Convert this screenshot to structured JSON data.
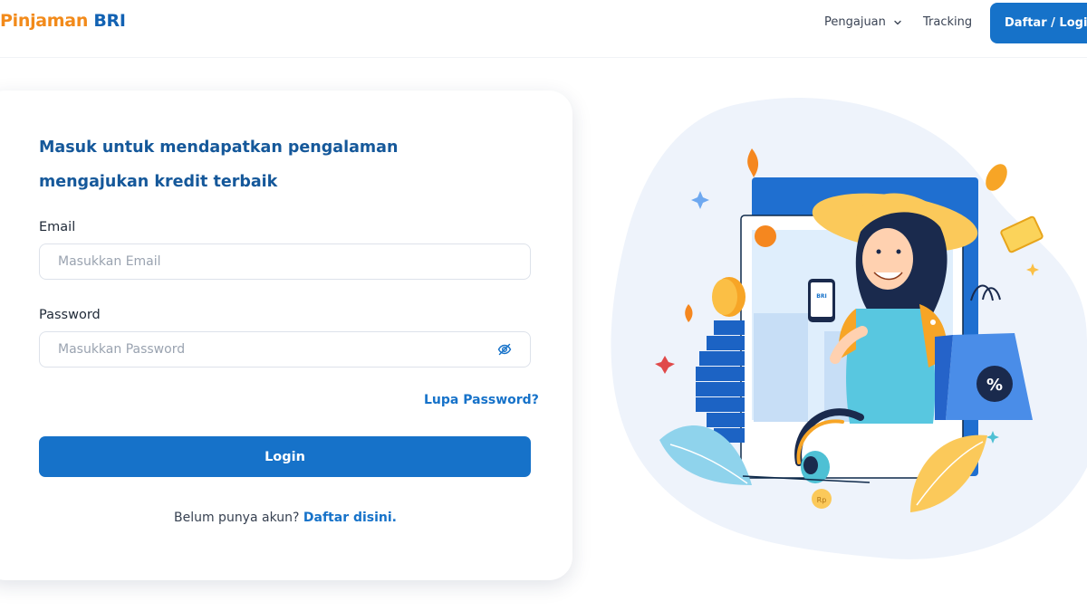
{
  "header": {
    "logo_part1": "Pinjaman",
    "logo_part2": "BRI",
    "nav": {
      "pengajuan": "Pengajuan",
      "tracking": "Tracking"
    },
    "auth_button": "Daftar / Login"
  },
  "form": {
    "heading": "Masuk untuk mendapatkan pengalaman mengajukan kredit terbaik",
    "email_label": "Email",
    "email_placeholder": "Masukkan Email",
    "password_label": "Password",
    "password_placeholder": "Masukkan Password",
    "forgot_link": "Lupa Password?",
    "submit_label": "Login",
    "register_prompt": "Belum punya akun?",
    "register_link": "Daftar disini."
  },
  "illustration": {
    "phone_brand": "BRI",
    "badge_symbol": "%",
    "coin_symbol": "Rp"
  },
  "colors": {
    "brand_blue": "#1672c9",
    "heading_blue": "#15589a",
    "brand_orange": "#f28a1a"
  }
}
